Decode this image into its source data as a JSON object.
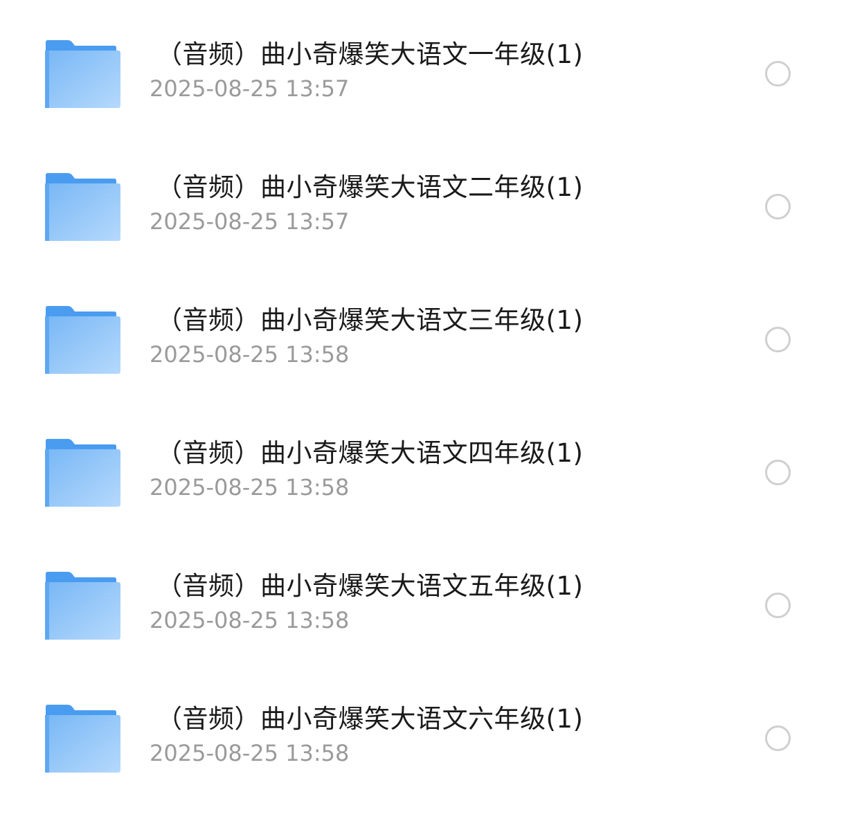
{
  "colors": {
    "folder_tab": "#4a9cf0",
    "folder_body_light": "#aed4fb",
    "folder_body_dark": "#78b7f5",
    "title_text": "#1a1a1a",
    "date_text": "#9a9a9a",
    "radio_border": "#cfcfcf"
  },
  "files": [
    {
      "name": "（音频）曲小奇爆笑大语文一年级(1)",
      "date": "2025-08-25 13:57",
      "icon": "folder-icon",
      "selected": false
    },
    {
      "name": "（音频）曲小奇爆笑大语文二年级(1)",
      "date": "2025-08-25 13:57",
      "icon": "folder-icon",
      "selected": false
    },
    {
      "name": "（音频）曲小奇爆笑大语文三年级(1)",
      "date": "2025-08-25 13:58",
      "icon": "folder-icon",
      "selected": false
    },
    {
      "name": "（音频）曲小奇爆笑大语文四年级(1)",
      "date": "2025-08-25 13:58",
      "icon": "folder-icon",
      "selected": false
    },
    {
      "name": "（音频）曲小奇爆笑大语文五年级(1)",
      "date": "2025-08-25 13:58",
      "icon": "folder-icon",
      "selected": false
    },
    {
      "name": "（音频）曲小奇爆笑大语文六年级(1)",
      "date": "2025-08-25 13:58",
      "icon": "folder-icon",
      "selected": false
    }
  ]
}
